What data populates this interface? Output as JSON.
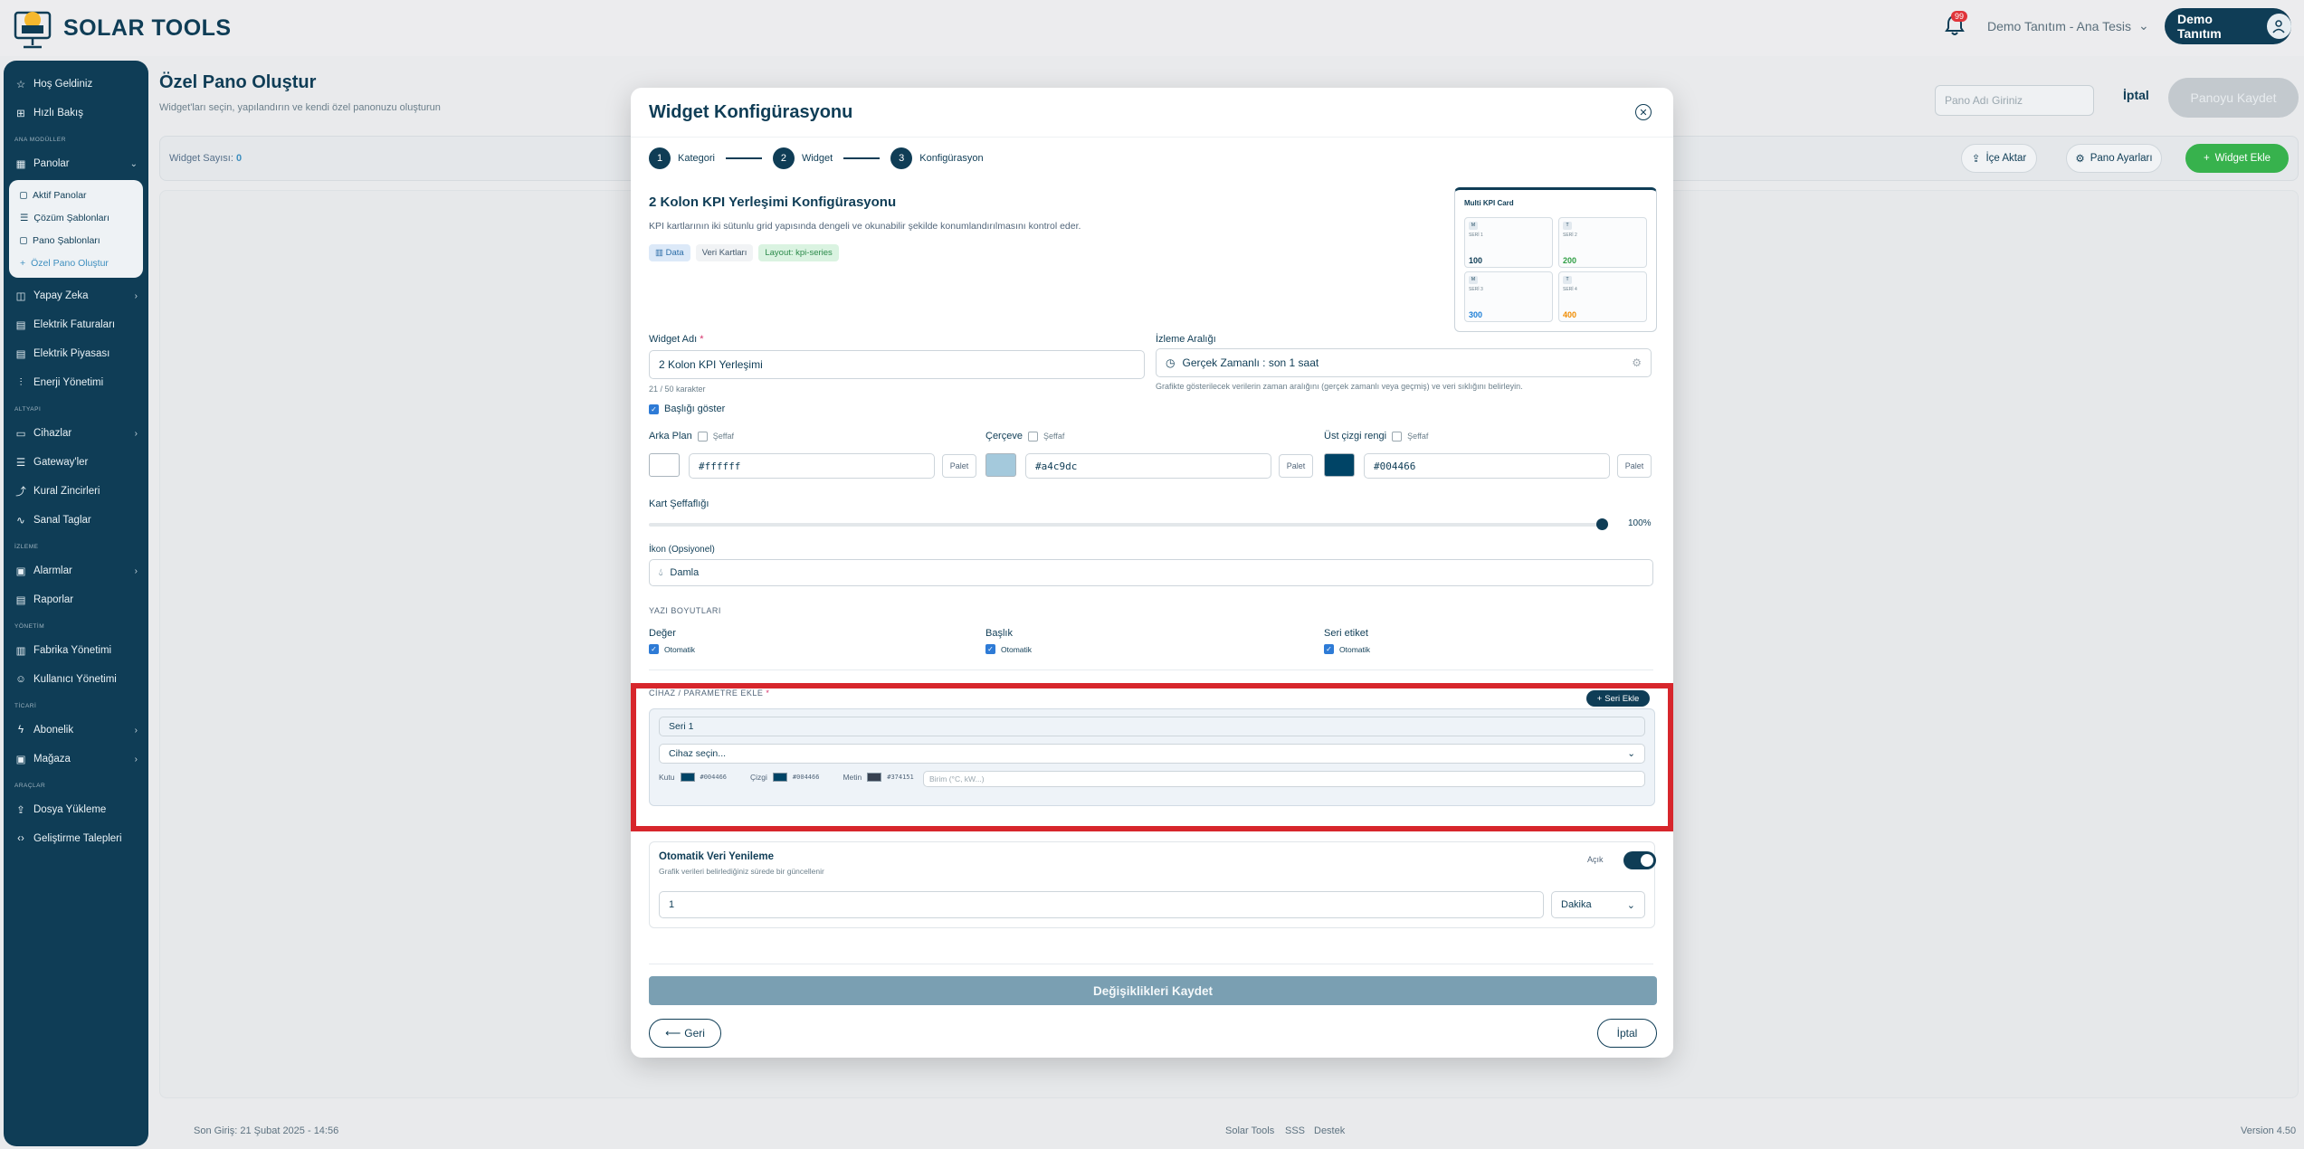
{
  "app": {
    "logo_text": "SOLAR TOOLS",
    "notification_count": "99"
  },
  "header": {
    "tenant": "Demo Tanıtım - Ana Tesis",
    "user": "Demo Tanıtım"
  },
  "sidebar": {
    "top_items": [
      {
        "label": "Hoş Geldiniz"
      },
      {
        "label": "Hızlı Bakış"
      }
    ],
    "section_ana": "ANA MODÜLLER",
    "panolar": "Panolar",
    "pano_sub": [
      {
        "label": "Aktif Panolar"
      },
      {
        "label": "Çözüm Şablonları"
      },
      {
        "label": "Pano Şablonları"
      },
      {
        "label": "Özel Pano Oluştur"
      }
    ],
    "main_items": [
      {
        "label": "Yapay Zeka"
      },
      {
        "label": "Elektrik Faturaları"
      },
      {
        "label": "Elektrik Piyasası"
      },
      {
        "label": "Enerji Yönetimi"
      }
    ],
    "section_altyapi": "ALTYAPI",
    "altyapi_items": [
      {
        "label": "Cihazlar"
      },
      {
        "label": "Gateway'ler"
      },
      {
        "label": "Kural Zincirleri"
      },
      {
        "label": "Sanal Taglar"
      }
    ],
    "section_izleme": "İZLEME",
    "izleme_items": [
      {
        "label": "Alarmlar"
      },
      {
        "label": "Raporlar"
      }
    ],
    "section_yonetim": "YÖNETİM",
    "yonetim_items": [
      {
        "label": "Fabrika Yönetimi"
      },
      {
        "label": "Kullanıcı Yönetimi"
      }
    ],
    "section_ticari": "TİCARİ",
    "ticari_items": [
      {
        "label": "Abonelik"
      },
      {
        "label": "Mağaza"
      }
    ],
    "section_araclar": "ARAÇLAR",
    "araclar_items": [
      {
        "label": "Dosya Yükleme"
      },
      {
        "label": "Geliştirme Talepleri"
      }
    ]
  },
  "page": {
    "title": "Özel Pano Oluştur",
    "subtitle": "Widget'ları seçin, yapılandırın ve kendi özel panonuzu oluşturun",
    "pane_name_placeholder": "Pano Adı Giriniz",
    "cancel": "İptal",
    "save": "Panoyu Kaydet",
    "widget_count_label": "Widget Sayısı:",
    "widget_count": "0",
    "import": "İçe Aktar",
    "pano_settings": "Pano Ayarları",
    "add_widget": "Widget Ekle"
  },
  "footer": {
    "last_login": "Son Giriş: 21 Şubat 2025 - 14:56",
    "links": [
      "Solar Tools",
      "SSS",
      "Destek"
    ],
    "version": "Version 4.50"
  },
  "modal": {
    "title": "Widget Konfigürasyonu",
    "steps": [
      {
        "num": "1",
        "label": "Kategori"
      },
      {
        "num": "2",
        "label": "Widget"
      },
      {
        "num": "3",
        "label": "Konfigürasyon"
      }
    ],
    "config_title": "2 Kolon KPI Yerleşimi Konfigürasyonu",
    "config_desc": "KPI kartlarının iki sütunlu grid yapısında dengeli ve okunabilir şekilde konumlandırılmasını kontrol eder.",
    "tags": [
      "Data",
      "Veri Kartları",
      "Layout: kpi-series"
    ],
    "preview": {
      "title": "Multi KPI Card",
      "cards": [
        {
          "icon": "M",
          "label": "SERİ 1",
          "value": "100",
          "color": "#0f3d56"
        },
        {
          "icon": "T",
          "label": "SERİ 2",
          "value": "200",
          "color": "#2f9e44"
        },
        {
          "icon": "M",
          "label": "SERİ 3",
          "value": "300",
          "color": "#1c7ed6"
        },
        {
          "icon": "T",
          "label": "SERİ 4",
          "value": "400",
          "color": "#f08c00"
        }
      ]
    },
    "widget_name_label": "Widget Adı",
    "widget_name_value": "2 Kolon KPI Yerleşimi",
    "char_count": "21 / 50 karakter",
    "izleme_label": "İzleme Aralığı",
    "izleme_value": "Gerçek Zamanlı : son 1 saat",
    "izleme_hint": "Grafikte gösterilecek verilerin zaman aralığını (gerçek zamanlı veya geçmiş) ve veri sıklığını belirleyin.",
    "show_title": "Başlığı göster",
    "bg_label": "Arka Plan",
    "frame_label": "Çerçeve",
    "topline_label": "Üst çizgi rengi",
    "transparent": "Şeffaf",
    "bg_color": "#ffffff",
    "frame_color": "#a4c9dc",
    "topline_color": "#004466",
    "palet": "Palet",
    "opacity_label": "Kart Şeffaflığı",
    "opacity_value": "100%",
    "opacity_fraction": 1.0,
    "icon_label": "İkon (Opsiyonel)",
    "icon_value": "Damla",
    "font_section": "YAZI BOYUTLARI",
    "font_value": "Değer",
    "font_title": "Başlık",
    "font_series": "Seri etiket",
    "auto": "Otomatik",
    "device_section": "CİHAZ / PARAMETRE EKLE",
    "add_series": "Seri Ekle",
    "series_name": "Seri 1",
    "device_select": "Cihaz seçin...",
    "kutu_label": "Kutu",
    "kutu_color": "#004466",
    "cizgi_label": "Çizgi",
    "cizgi_color": "#004466",
    "metin_label": "Metin",
    "metin_color": "#374151",
    "unit_placeholder": "Birim (°C, kW...)",
    "refresh_title": "Otomatik Veri Yenileme",
    "refresh_desc": "Grafik verileri belirlediğiniz sürede bir güncellenir",
    "refresh_state": "Açık",
    "refresh_value": "1",
    "refresh_unit": "Dakika",
    "save_changes": "Değişiklikleri Kaydet",
    "back": "Geri",
    "cancel": "İptal"
  }
}
